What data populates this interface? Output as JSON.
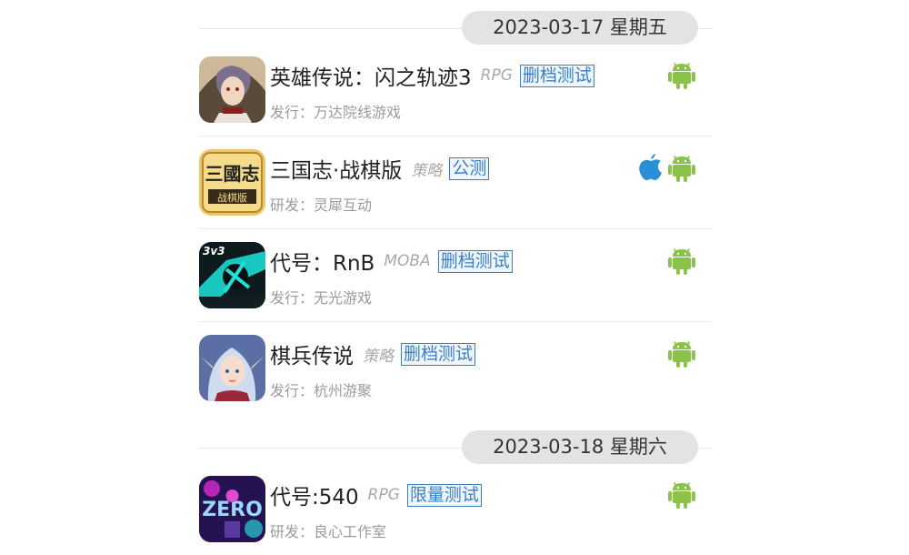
{
  "sections": [
    {
      "date": "2023-03-17 星期五",
      "games": [
        {
          "name": "英雄传说：闪之轨迹3",
          "genre": "RPG",
          "tag": "删档测试",
          "sub": "发行：万达院线游戏",
          "platforms": [
            "android"
          ],
          "icon": "hero-legend-icon"
        },
        {
          "name": "三国志·战棋版",
          "genre": "策略",
          "tag": "公测",
          "sub": "研发：灵犀互动",
          "platforms": [
            "ios",
            "android"
          ],
          "icon": "three-kingdoms-icon"
        },
        {
          "name": "代号：RnB",
          "genre": "MOBA",
          "tag": "删档测试",
          "sub": "发行：无光游戏",
          "platforms": [
            "android"
          ],
          "icon": "rnb-icon"
        },
        {
          "name": "棋兵传说",
          "genre": "策略",
          "tag": "删档测试",
          "sub": "发行：杭州游聚",
          "platforms": [
            "android"
          ],
          "icon": "elf-girl-icon"
        }
      ]
    },
    {
      "date": "2023-03-18 星期六",
      "games": [
        {
          "name": "代号:540",
          "genre": "RPG",
          "tag": "限量测试",
          "sub": "研发：良心工作室",
          "platforms": [
            "android"
          ],
          "icon": "zero-540-icon"
        }
      ]
    }
  ],
  "colors": {
    "tag": "#3a7fc6",
    "android": "#8bc34a",
    "ios": "#2a8fd6"
  }
}
